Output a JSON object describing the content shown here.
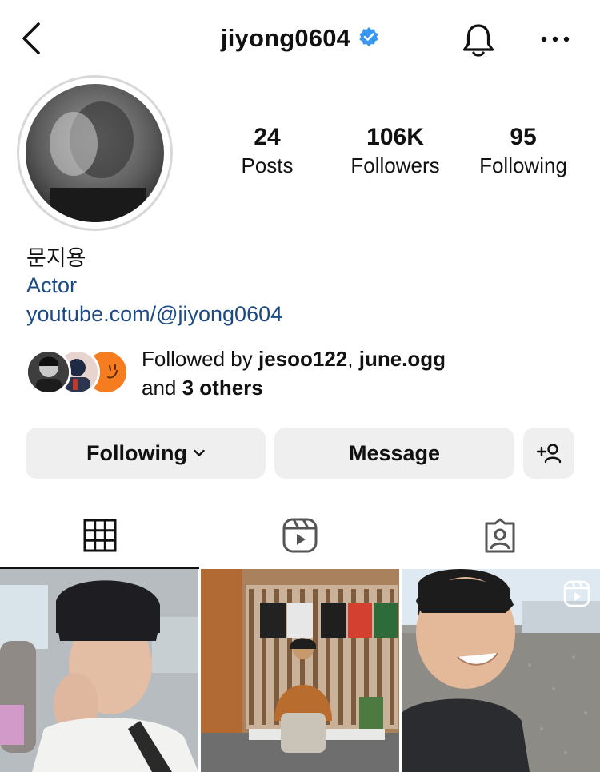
{
  "header": {
    "username": "jiyong0604",
    "verified": true,
    "icons": [
      "chevron-left-icon",
      "verified-badge-icon",
      "bell-icon",
      "more-horizontal-icon"
    ]
  },
  "stats": {
    "posts_count": "24",
    "posts_label": "Posts",
    "followers_count": "106K",
    "followers_label": "Followers",
    "following_count": "95",
    "following_label": "Following"
  },
  "profile": {
    "name": "문지용",
    "category": "Actor",
    "link": "youtube.com/@jiyong0604"
  },
  "followed_by": {
    "prefix": "Followed by ",
    "user1": "jesoo122",
    "separator": ", ",
    "user2": "june.ogg",
    "and_text": "and ",
    "others": "3 others"
  },
  "actions": {
    "following_label": "Following",
    "message_label": "Message"
  },
  "tabs": [
    "grid-icon",
    "reels-icon",
    "tagged-icon"
  ],
  "colors": {
    "link": "#1b4a85",
    "verified": "#3897f0",
    "button_bg": "#efefef",
    "accent_orange": "#f57c1f"
  }
}
